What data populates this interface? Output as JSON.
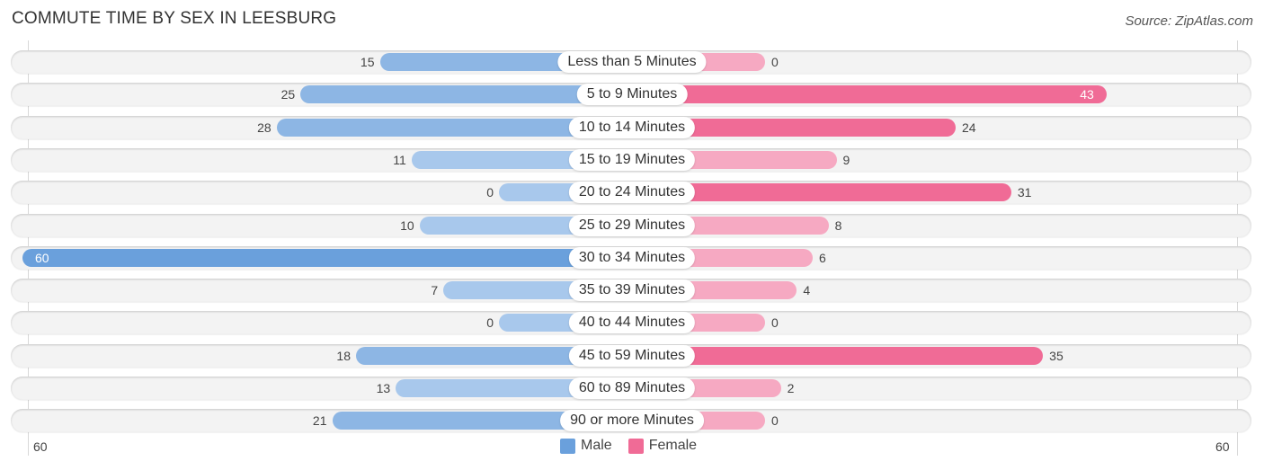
{
  "header": {
    "title": "COMMUTE TIME BY SEX IN LEESBURG",
    "source": "Source: ZipAtlas.com"
  },
  "colors": {
    "male_strong": "#6aa0dc",
    "male_light": "#a8c8ec",
    "female_strong": "#f06b96",
    "female_light": "#f6a9c2",
    "row_bg": "#f3f3f3"
  },
  "chart_data": {
    "type": "bar",
    "orientation": "horizontal-diverging",
    "title": "COMMUTE TIME BY SEX IN LEESBURG",
    "categories": [
      "Less than 5 Minutes",
      "5 to 9 Minutes",
      "10 to 14 Minutes",
      "15 to 19 Minutes",
      "20 to 24 Minutes",
      "25 to 29 Minutes",
      "30 to 34 Minutes",
      "35 to 39 Minutes",
      "40 to 44 Minutes",
      "45 to 59 Minutes",
      "60 to 89 Minutes",
      "90 or more Minutes"
    ],
    "series": [
      {
        "name": "Male",
        "side": "left",
        "values": [
          15,
          25,
          28,
          11,
          0,
          10,
          60,
          7,
          0,
          18,
          13,
          21
        ]
      },
      {
        "name": "Female",
        "side": "right",
        "values": [
          0,
          43,
          24,
          9,
          31,
          8,
          6,
          4,
          0,
          35,
          2,
          0
        ]
      }
    ],
    "axis": {
      "left_max_label": "60",
      "right_max_label": "60",
      "max": 60
    },
    "legend": {
      "position": "bottom-center",
      "entries": [
        "Male",
        "Female"
      ]
    },
    "grid": false
  }
}
